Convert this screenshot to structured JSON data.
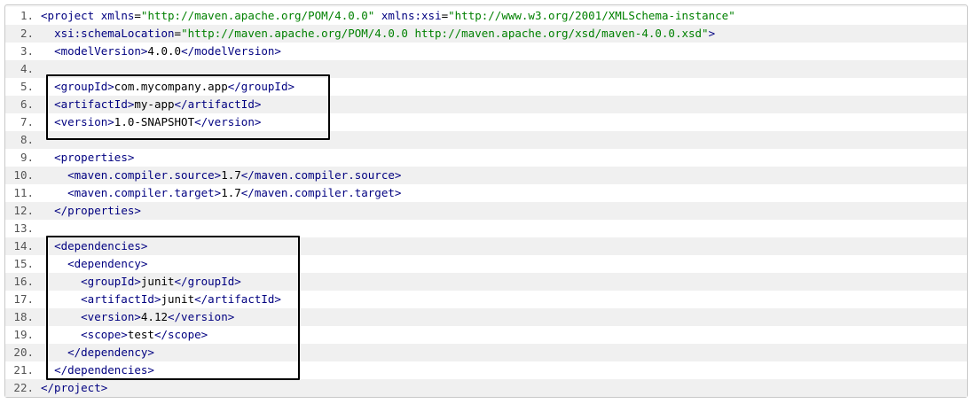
{
  "code": {
    "lines": [
      {
        "num": "1.",
        "indent": "",
        "parts": [
          [
            "tag",
            "<project"
          ],
          [
            "txt",
            " "
          ],
          [
            "attr",
            "xmlns"
          ],
          [
            "txt",
            "="
          ],
          [
            "val",
            "\"http://maven.apache.org/POM/4.0.0\""
          ],
          [
            "txt",
            " "
          ],
          [
            "attr",
            "xmlns:xsi"
          ],
          [
            "txt",
            "="
          ],
          [
            "val",
            "\"http://www.w3.org/2001/XMLSchema-instance\""
          ]
        ]
      },
      {
        "num": "2.",
        "indent": "  ",
        "parts": [
          [
            "attr",
            "xsi:schemaLocation"
          ],
          [
            "txt",
            "="
          ],
          [
            "val",
            "\"http://maven.apache.org/POM/4.0.0 http://maven.apache.org/xsd/maven-4.0.0.xsd\""
          ],
          [
            "tag",
            ">"
          ]
        ]
      },
      {
        "num": "3.",
        "indent": "  ",
        "parts": [
          [
            "tag",
            "<modelVersion>"
          ],
          [
            "txt",
            "4.0.0"
          ],
          [
            "tag",
            "</modelVersion>"
          ]
        ]
      },
      {
        "num": "4.",
        "indent": "",
        "parts": []
      },
      {
        "num": "5.",
        "indent": "  ",
        "parts": [
          [
            "tag",
            "<groupId>"
          ],
          [
            "txt",
            "com.mycompany.app"
          ],
          [
            "tag",
            "</groupId>"
          ]
        ]
      },
      {
        "num": "6.",
        "indent": "  ",
        "parts": [
          [
            "tag",
            "<artifactId>"
          ],
          [
            "txt",
            "my-app"
          ],
          [
            "tag",
            "</artifactId>"
          ]
        ]
      },
      {
        "num": "7.",
        "indent": "  ",
        "parts": [
          [
            "tag",
            "<version>"
          ],
          [
            "txt",
            "1.0-SNAPSHOT"
          ],
          [
            "tag",
            "</version>"
          ]
        ]
      },
      {
        "num": "8.",
        "indent": "",
        "parts": []
      },
      {
        "num": "9.",
        "indent": "  ",
        "parts": [
          [
            "tag",
            "<properties>"
          ]
        ]
      },
      {
        "num": "10.",
        "indent": "    ",
        "parts": [
          [
            "tag",
            "<maven.compiler.source>"
          ],
          [
            "txt",
            "1.7"
          ],
          [
            "tag",
            "</maven.compiler.source>"
          ]
        ]
      },
      {
        "num": "11.",
        "indent": "    ",
        "parts": [
          [
            "tag",
            "<maven.compiler.target>"
          ],
          [
            "txt",
            "1.7"
          ],
          [
            "tag",
            "</maven.compiler.target>"
          ]
        ]
      },
      {
        "num": "12.",
        "indent": "  ",
        "parts": [
          [
            "tag",
            "</properties>"
          ]
        ]
      },
      {
        "num": "13.",
        "indent": "",
        "parts": []
      },
      {
        "num": "14.",
        "indent": "  ",
        "parts": [
          [
            "tag",
            "<dependencies>"
          ]
        ]
      },
      {
        "num": "15.",
        "indent": "    ",
        "parts": [
          [
            "tag",
            "<dependency>"
          ]
        ]
      },
      {
        "num": "16.",
        "indent": "      ",
        "parts": [
          [
            "tag",
            "<groupId>"
          ],
          [
            "txt",
            "junit"
          ],
          [
            "tag",
            "</groupId>"
          ]
        ]
      },
      {
        "num": "17.",
        "indent": "      ",
        "parts": [
          [
            "tag",
            "<artifactId>"
          ],
          [
            "txt",
            "junit"
          ],
          [
            "tag",
            "</artifactId>"
          ]
        ]
      },
      {
        "num": "18.",
        "indent": "      ",
        "parts": [
          [
            "tag",
            "<version>"
          ],
          [
            "txt",
            "4.12"
          ],
          [
            "tag",
            "</version>"
          ]
        ]
      },
      {
        "num": "19.",
        "indent": "      ",
        "parts": [
          [
            "tag",
            "<scope>"
          ],
          [
            "txt",
            "test"
          ],
          [
            "tag",
            "</scope>"
          ]
        ]
      },
      {
        "num": "20.",
        "indent": "    ",
        "parts": [
          [
            "tag",
            "</dependency>"
          ]
        ]
      },
      {
        "num": "21.",
        "indent": "  ",
        "parts": [
          [
            "tag",
            "</dependencies>"
          ]
        ]
      },
      {
        "num": "22.",
        "indent": "",
        "parts": [
          [
            "tag",
            "</project>"
          ]
        ]
      }
    ]
  },
  "colors": {
    "tag": "#000080",
    "value": "#008000",
    "text": "#000000",
    "line_number": "#555555",
    "highlight_border": "#000000"
  },
  "highlights": [
    {
      "name": "coordinates-highlight",
      "from_line": 5,
      "to_line": 7
    },
    {
      "name": "dependencies-highlight",
      "from_line": 14,
      "to_line": 21
    }
  ]
}
